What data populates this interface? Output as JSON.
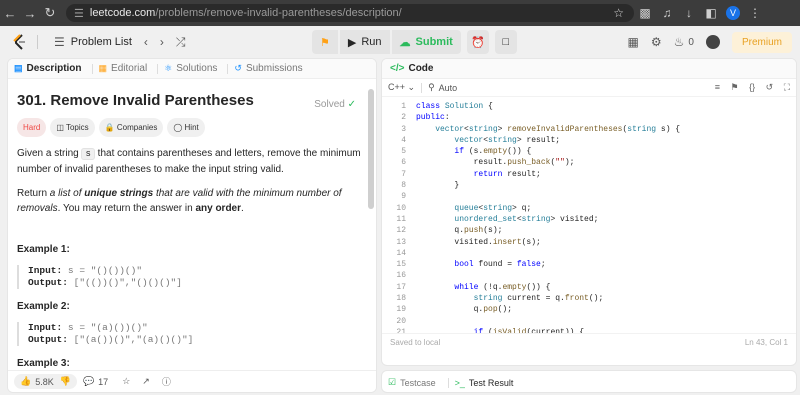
{
  "browser": {
    "url_host": "leetcode.com",
    "url_path": "/problems/remove-invalid-parentheses/description/",
    "profile_initial": "V"
  },
  "topbar": {
    "problem_list": "Problem List",
    "run": "Run",
    "submit": "Submit",
    "fire_count": "0",
    "premium": "Premium"
  },
  "left_tabs": [
    "Description",
    "Editorial",
    "Solutions",
    "Submissions"
  ],
  "problem": {
    "title": "301. Remove Invalid Parentheses",
    "status": "Solved",
    "chips": [
      "Hard",
      "Topics",
      "Companies",
      "Hint"
    ],
    "para1_a": "Given a string ",
    "para1_code": "s",
    "para1_b": " that contains parentheses and letters, remove the minimum number of invalid parentheses to make the input string valid.",
    "para2_a": "Return ",
    "para2_b": "a list of ",
    "para2_c": "unique strings",
    "para2_d": " that are valid with the minimum number of removals",
    "para2_e": ". You may return the answer in ",
    "para2_f": "any order",
    "para2_g": ".",
    "examples": [
      {
        "title": "Example 1:",
        "input_label": "Input:",
        "input": " s = \"()())()\"",
        "output_label": "Output:",
        "output": " [\"(())()\",\"()()()\"]"
      },
      {
        "title": "Example 2:",
        "input_label": "Input:",
        "input": " s = \"(a)())()\"",
        "output_label": "Output:",
        "output": " [\"(a())()\",\"(a)()()\"]"
      },
      {
        "title": "Example 3:"
      }
    ],
    "likes": "5.8K",
    "comments": "17"
  },
  "code_panel": {
    "title": "Code",
    "language": "C++",
    "mode": "Auto",
    "saved": "Saved to local",
    "cursor": "Ln 43, Col 1",
    "line_numbers": [
      "1",
      "2",
      "3",
      "4",
      "5",
      "6",
      "7",
      "8",
      "9",
      "10",
      "11",
      "12",
      "13",
      "14",
      "15",
      "16",
      "17",
      "18",
      "19",
      "20",
      "21"
    ]
  },
  "bottom_tabs": [
    "Testcase",
    "Test Result"
  ]
}
